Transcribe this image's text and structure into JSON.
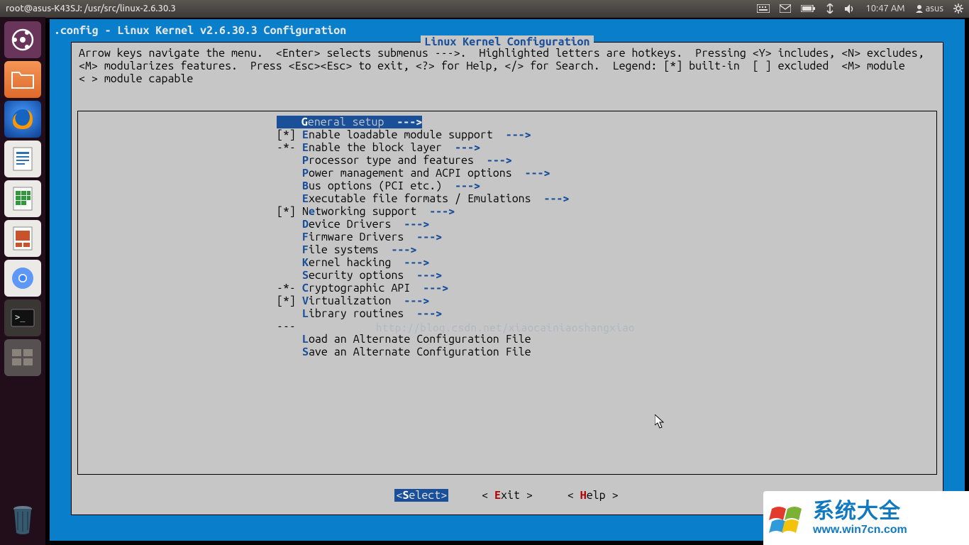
{
  "panel": {
    "title": "root@asus-K43SJ: /usr/src/linux-2.6.30.3",
    "time": "10:47 AM",
    "user": "asus"
  },
  "launcher": {
    "items": [
      "dash",
      "files",
      "firefox",
      "writer",
      "calc",
      "impress",
      "chromium",
      "terminal",
      "workspaces"
    ]
  },
  "menuconfig": {
    "window_title": ".config - Linux Kernel v2.6.30.3 Configuration",
    "box_title": "Linux Kernel Configuration",
    "help_lines": [
      "Arrow keys navigate the menu.  <Enter> selects submenus --->.  Highlighted letters are hotkeys.  Pressing <Y> includes, <N> excludes,",
      "<M> modularizes features.  Press <Esc><Esc> to exit, <?> for Help, </> for Search.  Legend: [*] built-in  [ ] excluded  <M> module",
      "< > module capable"
    ],
    "items": [
      {
        "mark": "   ",
        "hot": "G",
        "rest": "eneral setup  ",
        "arrow": "--->",
        "selected": true
      },
      {
        "mark": "[*]",
        "hot": "E",
        "rest": "nable loadable module support  ",
        "arrow": "--->"
      },
      {
        "mark": "-*-",
        "hot": "E",
        "rest": "nable the block layer  ",
        "arrow": "--->"
      },
      {
        "mark": "   ",
        "hot": "P",
        "rest": "rocessor type and features  ",
        "arrow": "--->"
      },
      {
        "mark": "   ",
        "hot": "P",
        "rest": "ower management and ACPI options  ",
        "arrow": "--->"
      },
      {
        "mark": "   ",
        "hot": "B",
        "rest": "us options (PCI etc.)  ",
        "arrow": "--->"
      },
      {
        "mark": "   ",
        "hot": "E",
        "rest": "xecutable file formats / Emulations  ",
        "arrow": "--->"
      },
      {
        "mark": "[*]",
        "pre": "N",
        "hot": "e",
        "rest": "tworking support  ",
        "arrow": "--->"
      },
      {
        "mark": "   ",
        "hot": "D",
        "rest": "evice Drivers  ",
        "arrow": "--->"
      },
      {
        "mark": "   ",
        "hot": "F",
        "rest": "irmware Drivers  ",
        "arrow": "--->"
      },
      {
        "mark": "   ",
        "hot": "F",
        "rest": "ile systems  ",
        "arrow": "--->"
      },
      {
        "mark": "   ",
        "hot": "K",
        "rest": "ernel hacking  ",
        "arrow": "--->"
      },
      {
        "mark": "   ",
        "hot": "S",
        "rest": "ecurity options  ",
        "arrow": "--->"
      },
      {
        "mark": "-*-",
        "hot": "C",
        "rest": "ryptographic API  ",
        "arrow": "--->"
      },
      {
        "mark": "[*]",
        "hot": "V",
        "rest": "irtualization  ",
        "arrow": "--->"
      },
      {
        "mark": "   ",
        "hot": "L",
        "rest": "ibrary routines  ",
        "arrow": "--->"
      },
      {
        "mark": "---",
        "hot": "",
        "rest": "",
        "arrow": ""
      },
      {
        "mark": "   ",
        "hot": "L",
        "rest": "oad an Alternate Configuration File",
        "arrow": ""
      },
      {
        "mark": "   ",
        "hot": "S",
        "rest": "ave an Alternate Configuration File",
        "arrow": ""
      }
    ],
    "buttons": {
      "select": {
        "l": "<",
        "hot": "S",
        "rest": "elect",
        "r": ">",
        "selected": true
      },
      "exit": {
        "l": "< ",
        "hot": "E",
        "rest": "xit ",
        "r": ">"
      },
      "help": {
        "l": "< ",
        "hot": "H",
        "rest": "elp ",
        "r": ">"
      }
    }
  },
  "watermark": "http://blog.csdn.net/xiaocainiaoshangxiao",
  "badge": {
    "text": "系统大全",
    "url": "www.win7cn.com"
  }
}
